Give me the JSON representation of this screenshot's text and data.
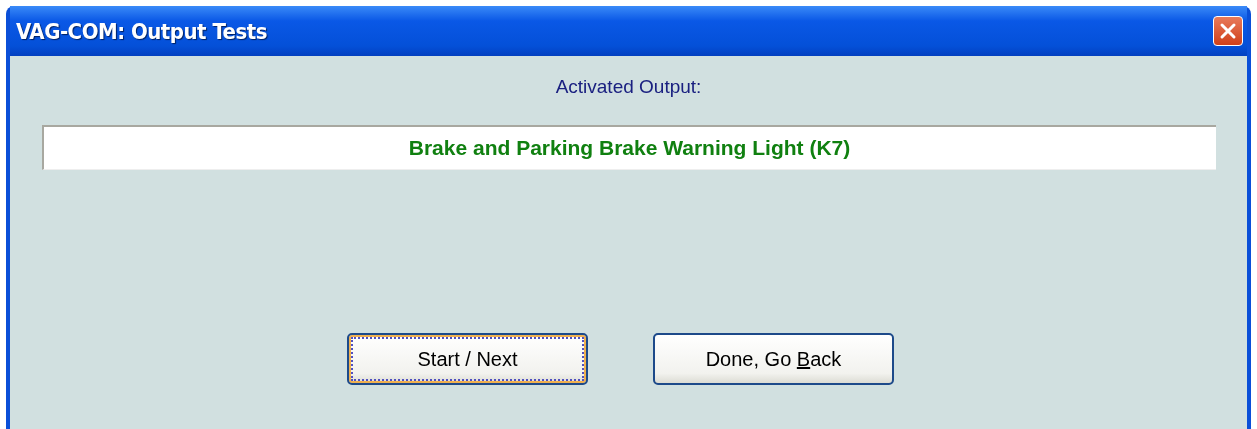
{
  "window": {
    "title": "VAG-COM: Output Tests"
  },
  "output_label": "Activated Output:",
  "output_value": "Brake and Parking Brake Warning Light (K7)",
  "buttons": [
    {
      "label_parts": [
        "Start / Next"
      ],
      "focused": true
    },
    {
      "label_parts": [
        "Done, Go ",
        "B",
        "ack"
      ],
      "focused": false
    }
  ]
}
